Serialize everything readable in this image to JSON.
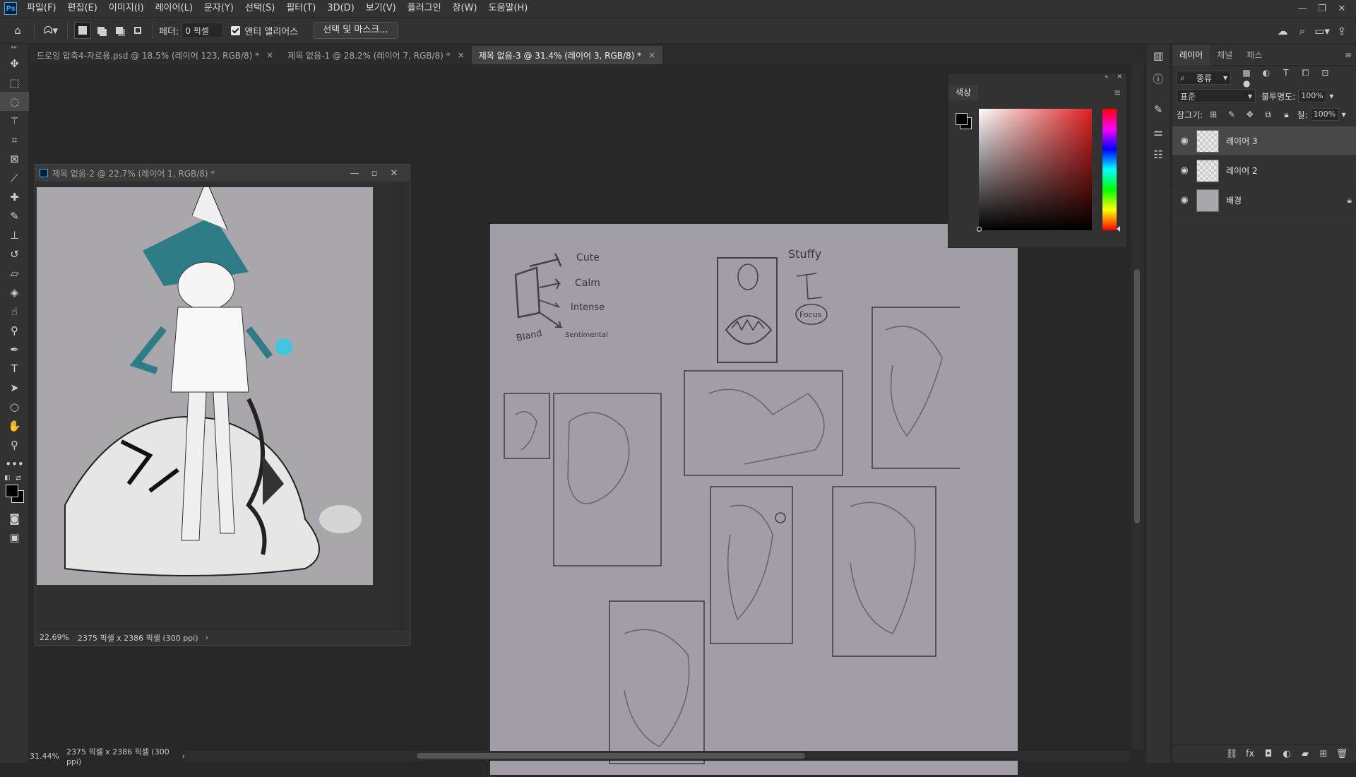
{
  "app": {
    "logo": "Ps"
  },
  "menu": [
    "파일(F)",
    "편집(E)",
    "이미지(I)",
    "레이어(L)",
    "문자(Y)",
    "선택(S)",
    "필터(T)",
    "3D(D)",
    "보기(V)",
    "플러그인",
    "창(W)",
    "도움말(H)"
  ],
  "options": {
    "feather_label": "페더:",
    "feather_value": "0 픽셀",
    "antialias_label": "앤티 앨리어스",
    "select_mask_button": "선택 및 마스크..."
  },
  "tabs": [
    {
      "title": "드로잉 압축4-자료용.psd @ 18.5% (레이어 123, RGB/8) *",
      "active": false
    },
    {
      "title": "제목 없음-1 @ 28.2% (레이어 7, RGB/8) *",
      "active": false
    },
    {
      "title": "제목 없음-3 @ 31.4% (레이어 3, RGB/8) *",
      "active": true
    }
  ],
  "floating_window": {
    "title": "제목 없음-2 @ 22.7% (레이어 1, RGB/8) *",
    "zoom": "22.69%",
    "doc_info": "2375 픽셀 x 2386 픽셀 (300 ppi)"
  },
  "canvas_notes": {
    "cute": "Cute",
    "calm": "Calm",
    "intense": "Intense",
    "sentimental": "Sentimental",
    "bland": "Bland",
    "stuffy": "Stuffy",
    "focus": "Focus"
  },
  "color_panel": {
    "title": "색상"
  },
  "layers_panel": {
    "tabs": [
      "레이어",
      "채널",
      "패스"
    ],
    "filter_label": "종류",
    "blend_mode": "표준",
    "opacity_label": "불투명도:",
    "opacity_value": "100%",
    "lock_label": "잠그기:",
    "fill_label": "칠:",
    "fill_value": "100%",
    "layers": [
      {
        "name": "레이어 3",
        "selected": true,
        "locked": false
      },
      {
        "name": "레이어 2",
        "selected": false,
        "locked": false
      },
      {
        "name": "배경",
        "selected": false,
        "locked": true
      }
    ]
  },
  "status": {
    "zoom": "31.44%",
    "doc_info": "2375 픽셀 x 2386 픽셀 (300 ppi)"
  }
}
